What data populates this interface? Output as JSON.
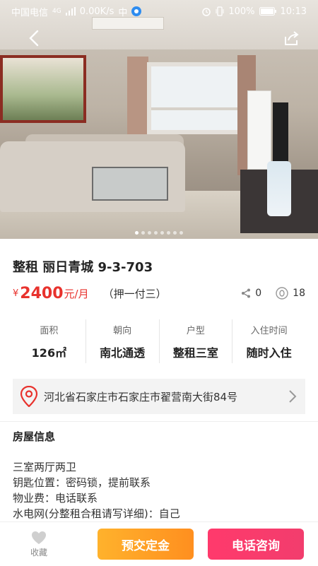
{
  "status_bar": {
    "carrier": "中国电信",
    "network": "4G",
    "speed": "0.00K/s",
    "ime": "中",
    "battery": "100%",
    "time": "10:13"
  },
  "hero": {
    "image_count": 8,
    "active_index": 0
  },
  "listing": {
    "title": "整租 丽日青城 9-3-703",
    "currency": "¥",
    "price": "2400",
    "price_unit": "元/月",
    "deposit_terms": "（押一付三）",
    "share_count": "0",
    "view_count": "18"
  },
  "info": [
    {
      "label": "面积",
      "value": "126㎡"
    },
    {
      "label": "朝向",
      "value": "南北通透"
    },
    {
      "label": "户型",
      "value": "整租三室"
    },
    {
      "label": "入住时间",
      "value": "随时入住"
    }
  ],
  "address": "河北省石家庄市石家庄市翟营南大街84号",
  "section": {
    "title": "房屋信息",
    "lines": [
      "三室两厅两卫",
      "钥匙位置：密码锁，提前联系",
      "物业费：电话联系",
      "水电网(分整租合租请写详细)：自己"
    ]
  },
  "bottom": {
    "favorite_label": "收藏",
    "deposit_button": "预交定金",
    "call_button": "电话咨询"
  },
  "colors": {
    "price_red": "#e8322d",
    "deposit_orange": "#ff9d24",
    "call_pink": "#f23d6d"
  }
}
